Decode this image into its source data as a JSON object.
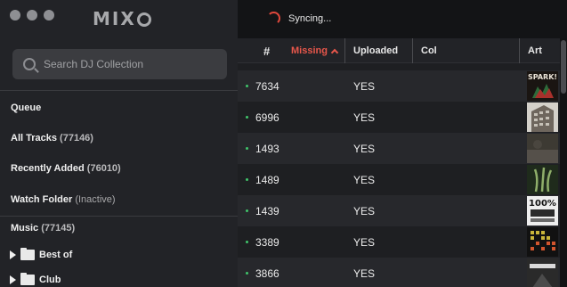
{
  "app": {
    "window_buttons": [
      "close",
      "minimize",
      "zoom"
    ],
    "logo_text": "MIX"
  },
  "sidebar": {
    "search_placeholder": "Search DJ Collection",
    "queue_label": "Queue",
    "all_tracks_label": "All Tracks",
    "all_tracks_count": "(77146)",
    "recently_added_label": "Recently Added",
    "recently_added_count": "(76010)",
    "watch_folder_label": "Watch Folder",
    "watch_folder_status": "(Inactive)",
    "music_label": "Music",
    "music_count": "(77145)",
    "folders": [
      {
        "label": "Best of"
      },
      {
        "label": "Club"
      }
    ]
  },
  "status": {
    "sync_text": "Syncing..."
  },
  "table": {
    "columns": {
      "number": "#",
      "missing": "Missing",
      "uploaded": "Uploaded",
      "col": "Col",
      "art": "Art"
    },
    "sort_column": "missing",
    "rows": [
      {
        "number": "7634",
        "uploaded": "YES"
      },
      {
        "number": "6996",
        "uploaded": "YES"
      },
      {
        "number": "1493",
        "uploaded": "YES"
      },
      {
        "number": "1489",
        "uploaded": "YES"
      },
      {
        "number": "1439",
        "uploaded": "YES"
      },
      {
        "number": "3389",
        "uploaded": "YES"
      },
      {
        "number": "3866",
        "uploaded": "YES"
      }
    ]
  },
  "artwork": {
    "row_0_text": "SPARK!",
    "row_4_text": "100%"
  },
  "colors": {
    "accent": "#e8574b",
    "status_dot": "#3fc46a"
  }
}
